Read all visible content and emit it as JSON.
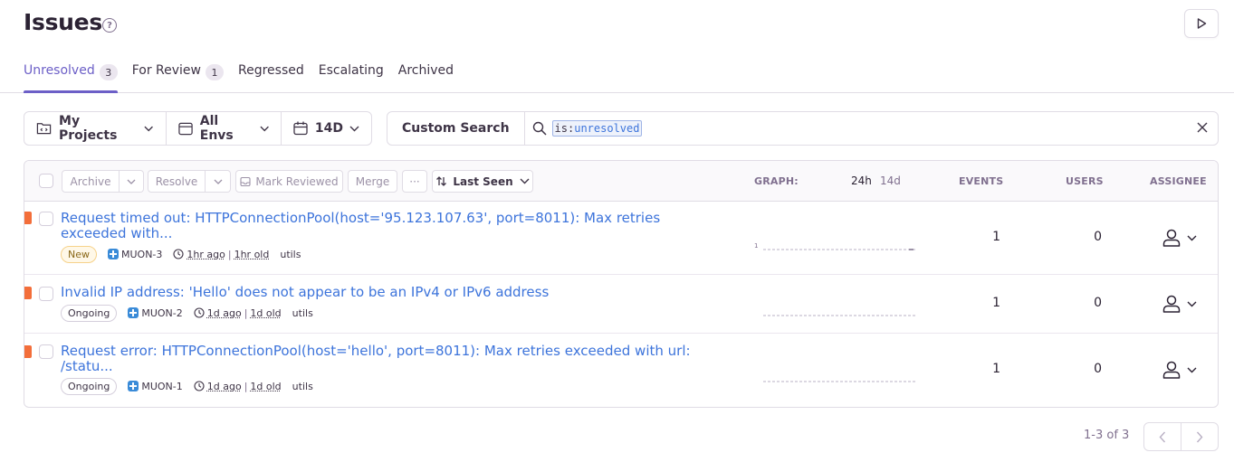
{
  "header": {
    "title": "Issues",
    "help": "?"
  },
  "tabs": [
    {
      "label": "Unresolved",
      "count": "3",
      "active": true
    },
    {
      "label": "For Review",
      "count": "1"
    },
    {
      "label": "Regressed"
    },
    {
      "label": "Escalating"
    },
    {
      "label": "Archived"
    }
  ],
  "filters": {
    "projects": "My Projects",
    "envs": "All Envs",
    "period": "14D"
  },
  "search": {
    "label": "Custom Search",
    "token_key": "is:",
    "token_value": "unresolved"
  },
  "actions": {
    "archive": "Archive",
    "resolve": "Resolve",
    "mark_reviewed": "Mark Reviewed",
    "merge": "Merge",
    "more": "···",
    "sort": "Last Seen"
  },
  "columns": {
    "graph": "GRAPH:",
    "graph_24h": "24h",
    "graph_14d": "14d",
    "events": "EVENTS",
    "users": "USERS",
    "assignee": "ASSIGNEE"
  },
  "issues": [
    {
      "title": "Request timed out: HTTPConnectionPool(host='95.123.107.63', port=8011): Max retries exceeded with...",
      "status": "New",
      "project": "MUON-3",
      "last_seen": "1hr ago",
      "age": "1hr old",
      "logger": "utils",
      "graph_label": "1",
      "events": "1",
      "users": "0"
    },
    {
      "title": "Invalid IP address: 'Hello' does not appear to be an IPv4 or IPv6 address",
      "status": "Ongoing",
      "project": "MUON-2",
      "last_seen": "1d ago",
      "age": "1d old",
      "logger": "utils",
      "events": "1",
      "users": "0"
    },
    {
      "title": "Request error: HTTPConnectionPool(host='hello', port=8011): Max retries exceeded with url: /statu...",
      "status": "Ongoing",
      "project": "MUON-1",
      "last_seen": "1d ago",
      "age": "1d old",
      "logger": "utils",
      "events": "1",
      "users": "0"
    }
  ],
  "pagination": {
    "text": "1-3 of 3"
  },
  "colors": {
    "accent": "#6c5fc7",
    "link": "#3d74db",
    "priority": "#f36e3a"
  }
}
